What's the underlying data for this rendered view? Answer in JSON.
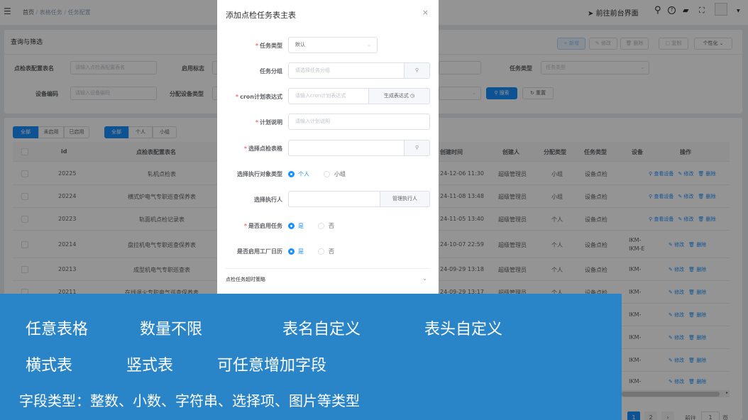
{
  "topbar": {
    "breadcrumb": [
      "首页",
      "表格任务",
      "任务配置"
    ],
    "front_link": "前往前台界面"
  },
  "filter": {
    "title": "查询与筛选",
    "fields": [
      {
        "label": "点检表配置表名",
        "placeholder": "请输入点检表配置表名"
      },
      {
        "label": "启用标志",
        "placeholder": ""
      },
      {
        "label": "任务类型",
        "placeholder": "任务类型"
      },
      {
        "label": "设备编码",
        "placeholder": "请输入设备编码"
      },
      {
        "label": "分配设备类型",
        "placeholder": ""
      }
    ],
    "search": "搜索",
    "reset": "重置"
  },
  "toolbar": {
    "add": "+ 新增",
    "edit": "修改",
    "delete": "删除",
    "copy": "复制",
    "personalize": "个性化"
  },
  "segments": {
    "group1": [
      "全部",
      "未启用",
      "已启用"
    ],
    "group2": [
      "全部",
      "个人",
      "小组"
    ]
  },
  "table": {
    "headers": [
      "id",
      "点检表配置表名",
      "创建时间",
      "创建人",
      "分配类型",
      "任务类型",
      "设备",
      "操作"
    ],
    "rows": [
      {
        "id": "20225",
        "name": "轧机点检表",
        "time": "24-12-06 11:30",
        "creator": "超级管理员",
        "assign": "小组",
        "type": "设备点检",
        "device": "",
        "ops": [
          "查看设备",
          "修改",
          "删除"
        ]
      },
      {
        "id": "20224",
        "name": "横式炉电气专职巡查保养表",
        "time": "24-11-08 13:48",
        "creator": "超级管理员",
        "assign": "小组",
        "type": "设备点检",
        "device": "",
        "ops": [
          "查看设备",
          "修改",
          "删除"
        ]
      },
      {
        "id": "20223",
        "name": "轨面机点检记录表",
        "time": "24-11-05 13:40",
        "creator": "超级管理员",
        "assign": "个人",
        "type": "设备点检",
        "device": "",
        "ops": [
          "查看设备",
          "修改",
          "删除"
        ]
      },
      {
        "id": "20214",
        "name": "盘拉机电气专职巡查保养表",
        "time": "24-10-07 22:59",
        "creator": "超级管理员",
        "assign": "个人",
        "type": "设备点检",
        "device": "IKM-",
        "device2": "IKM-E",
        "ops": [
          "修改",
          "删除"
        ]
      },
      {
        "id": "20213",
        "name": "成型机电气专职巡查表",
        "time": "24-09-29 13:18",
        "creator": "超级管理员",
        "assign": "个人",
        "type": "设备点检",
        "device": "IKM-",
        "ops": [
          "修改",
          "删除"
        ]
      },
      {
        "id": "20211",
        "name": "在线退火专职电气巡查保养表",
        "time": "24-09-29 13:17",
        "creator": "超级管理员",
        "assign": "个人",
        "type": "设备点检",
        "device": "IKM-",
        "ops": [
          "修改",
          "删除"
        ]
      },
      {
        "id": "",
        "name": "",
        "time": "",
        "creator": "",
        "assign": "",
        "type": "",
        "device": "IKM-",
        "ops": [
          "修改",
          "删除"
        ]
      },
      {
        "id": "",
        "name": "",
        "time": "",
        "creator": "",
        "assign": "",
        "type": "",
        "device": "IKM-",
        "ops": [
          "修改",
          "删除"
        ]
      },
      {
        "id": "",
        "name": "",
        "time": "",
        "creator": "",
        "assign": "",
        "type": "",
        "device": "IKM-",
        "ops": [
          "修改",
          "删除"
        ]
      },
      {
        "id": "",
        "name": "",
        "time": "",
        "creator": "",
        "assign": "",
        "type": "",
        "device": "IKM-",
        "ops": [
          "修改",
          "删除"
        ]
      }
    ]
  },
  "pagination": {
    "pages": [
      "1",
      "2"
    ],
    "goto": "前往",
    "page_value": "1",
    "page_unit": "页"
  },
  "modal": {
    "title": "添加点检任务表主表",
    "task_type": {
      "label": "任务类型",
      "value": "默认"
    },
    "task_group": {
      "label": "任务分组",
      "placeholder": "请选择任务分组"
    },
    "cron": {
      "label": "cron计划表达式",
      "placeholder": "请输入cron计划表达式",
      "button": "生成表达式"
    },
    "plan_desc": {
      "label": "计划说明",
      "placeholder": "请输入计划说明"
    },
    "form_select": {
      "label": "选择点检表格",
      "placeholder": ""
    },
    "exec_type": {
      "label": "选择执行对象类型",
      "options": [
        "个人",
        "小组"
      ],
      "selected": "个人"
    },
    "executor": {
      "label": "选择执行人",
      "placeholder": "",
      "button": "管理执行人"
    },
    "enable": {
      "label": "是否启用任务",
      "options": [
        "是",
        "否"
      ],
      "selected": "是"
    },
    "calendar": {
      "label": "是否启用工厂日历",
      "options": [
        "是",
        "否"
      ],
      "selected": "是"
    },
    "timeout_section": "点检任务超时策略"
  },
  "banner": {
    "line1": [
      "任意表格",
      "数量不限",
      "表名自定义",
      "表头自定义"
    ],
    "line2": [
      "横式表",
      "竖式表",
      "可任意增加字段"
    ],
    "line3": "字段类型：整数、小数、字符串、选择项、图片等类型"
  },
  "colors": {
    "primary": "#1890ff",
    "banner": "#2a84c8",
    "required": "#f56c6c"
  }
}
